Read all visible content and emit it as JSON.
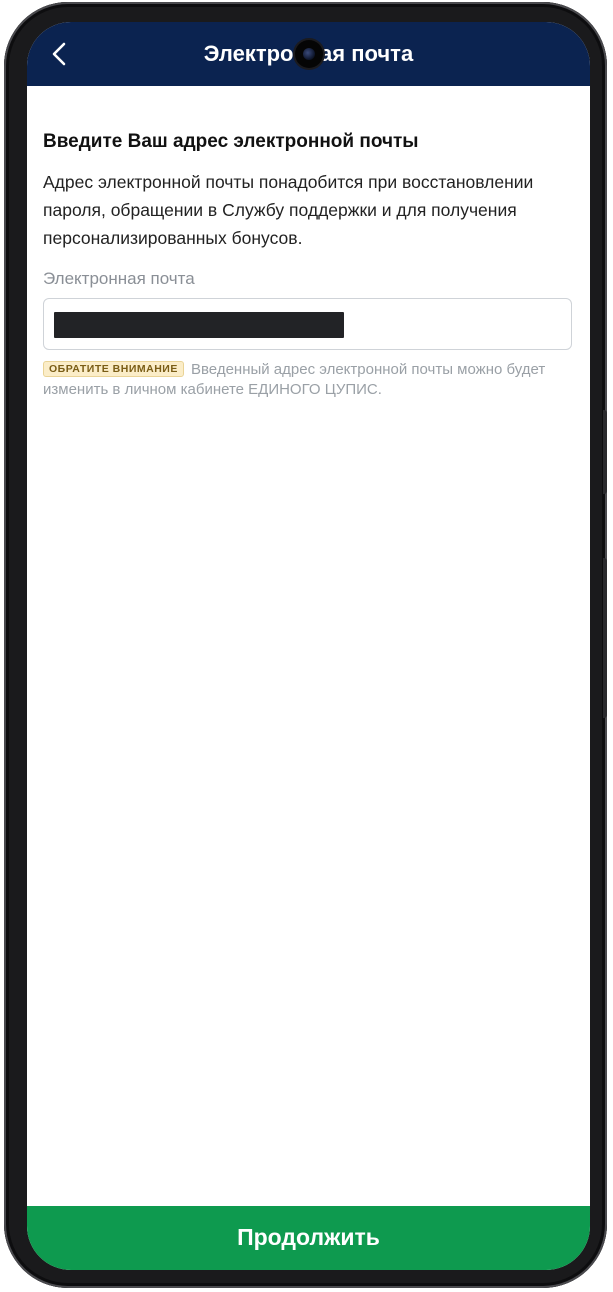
{
  "header": {
    "title": "Электронная почта",
    "back_icon": "chevron-left-icon"
  },
  "main": {
    "heading": "Введите Ваш адрес электронной почты",
    "description": "Адрес электронной почты понадобится при восстановлении пароля, обращении в Службу поддержки и для получения персонализированных бонусов.",
    "email_label": "Электронная почта",
    "email_value": "",
    "note_badge": "ОБРАТИТЕ ВНИМАНИЕ",
    "note_text": "Введенный адрес электронной почты можно будет изменить в личном кабинете ЕДИНОГО ЦУПИС."
  },
  "footer": {
    "continue_label": "Продолжить"
  },
  "colors": {
    "header_bg": "#0b2350",
    "cta_bg": "#0e9a4f",
    "badge_bg": "#fbedc8",
    "badge_text": "#7a5d16"
  }
}
